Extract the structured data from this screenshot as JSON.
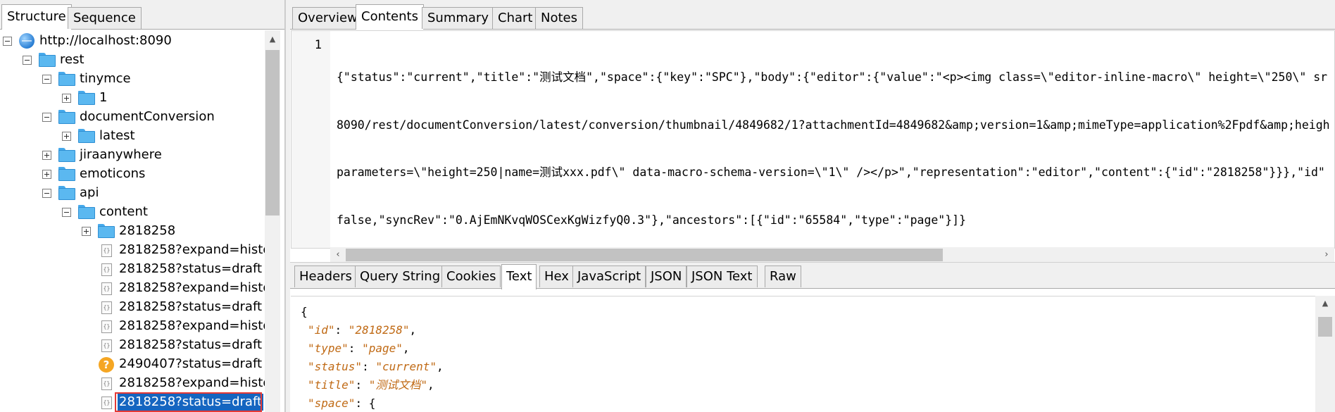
{
  "left_tabs": [
    "Structure",
    "Sequence"
  ],
  "tree": {
    "root": "http://localhost:8090",
    "rest": "rest",
    "tinymce": "tinymce",
    "tinymce_child": "1",
    "documentConversion": "documentConversion",
    "latest": "latest",
    "jiraanywhere": "jiraanywhere",
    "emoticons": "emoticons",
    "api": "api",
    "content": "content",
    "folder_2818258": "2818258",
    "requests": [
      {
        "label": "2818258?expand=histo",
        "icon": "json-document-icon"
      },
      {
        "label": "2818258?status=draft",
        "icon": "json-document-icon"
      },
      {
        "label": "2818258?expand=histo",
        "icon": "json-document-icon"
      },
      {
        "label": "2818258?status=draft",
        "icon": "json-document-icon"
      },
      {
        "label": "2818258?expand=histo",
        "icon": "json-document-icon"
      },
      {
        "label": "2818258?status=draft",
        "icon": "json-document-icon"
      },
      {
        "label": "2490407?status=draft",
        "icon": "question-icon"
      },
      {
        "label": "2818258?expand=histo",
        "icon": "json-document-icon"
      },
      {
        "label": "2818258?status=draft",
        "icon": "json-document-icon",
        "selected": true
      }
    ]
  },
  "right_tabs": [
    "Overview",
    "Contents",
    "Summary",
    "Chart",
    "Notes"
  ],
  "active_right_tab": "Contents",
  "editor": {
    "line_number": "1",
    "lines": [
      "{\"status\":\"current\",\"title\":\"测试文档\",\"space\":{\"key\":\"SPC\"},\"body\":{\"editor\":{\"value\":\"<p><img class=\\\"editor-inline-macro\\\" height=\\\"250\\\" sr",
      "8090/rest/documentConversion/latest/conversion/thumbnail/4849682/1?attachmentId=4849682&amp;version=1&amp;mimeType=application%2Fpdf&amp;heigh",
      "parameters=\\\"height=250|name=测试xxx.pdf\\\" data-macro-schema-version=\\\"1\\\" /></p>\",\"representation\":\"editor\",\"content\":{\"id\":\"2818258\"}}},\"id\"",
      "false,\"syncRev\":\"0.AjEmNKvqWOSCexKgWizfyQ0.3\"},\"ancestors\":[{\"id\":\"65584\",\"type\":\"page\"}]}"
    ]
  },
  "sub_tabs": [
    "Headers",
    "Query String",
    "Cookies",
    "Text",
    "Hex",
    "JavaScript",
    "JSON",
    "JSON Text",
    "Raw"
  ],
  "active_sub_tab": "Text",
  "json_view": {
    "open_brace": "{",
    "rows": [
      {
        "key": "\"id\"",
        "value": "\"2818258\"",
        "tail": ","
      },
      {
        "key": "\"type\"",
        "value": "\"page\"",
        "tail": ","
      },
      {
        "key": "\"status\"",
        "value": "\"current\"",
        "tail": ","
      },
      {
        "key": "\"title\"",
        "value": "\"测试文档\"",
        "tail": ","
      },
      {
        "key": "\"space\"",
        "value": "{",
        "tail": ""
      }
    ]
  },
  "colors": {
    "selection": "#1565c0",
    "selection_outline": "#e53935",
    "json_key_value": "#c06a15",
    "folder": "#5bb8f0"
  }
}
